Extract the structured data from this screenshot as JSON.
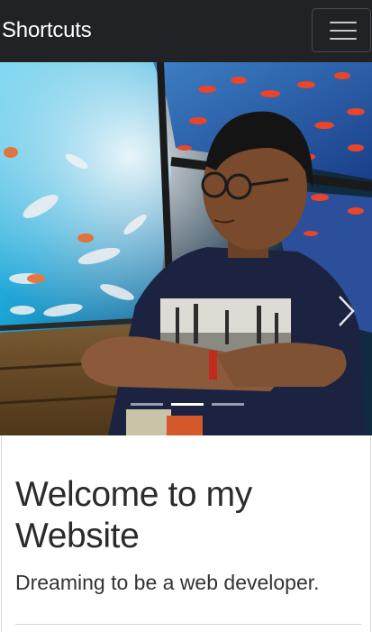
{
  "navbar": {
    "brand": "Shortcuts",
    "toggler_icon": "hamburger-menu-icon"
  },
  "carousel": {
    "image_description_icon": "profile-photo",
    "next_icon": "chevron-right-icon",
    "slide_count": 3,
    "active_slide": 2
  },
  "content": {
    "heading": "Welcome to my Website",
    "lead": "Dreaming to be a web developer."
  },
  "colors": {
    "navbar_bg": "#212226",
    "text": "#2b2b2b"
  }
}
